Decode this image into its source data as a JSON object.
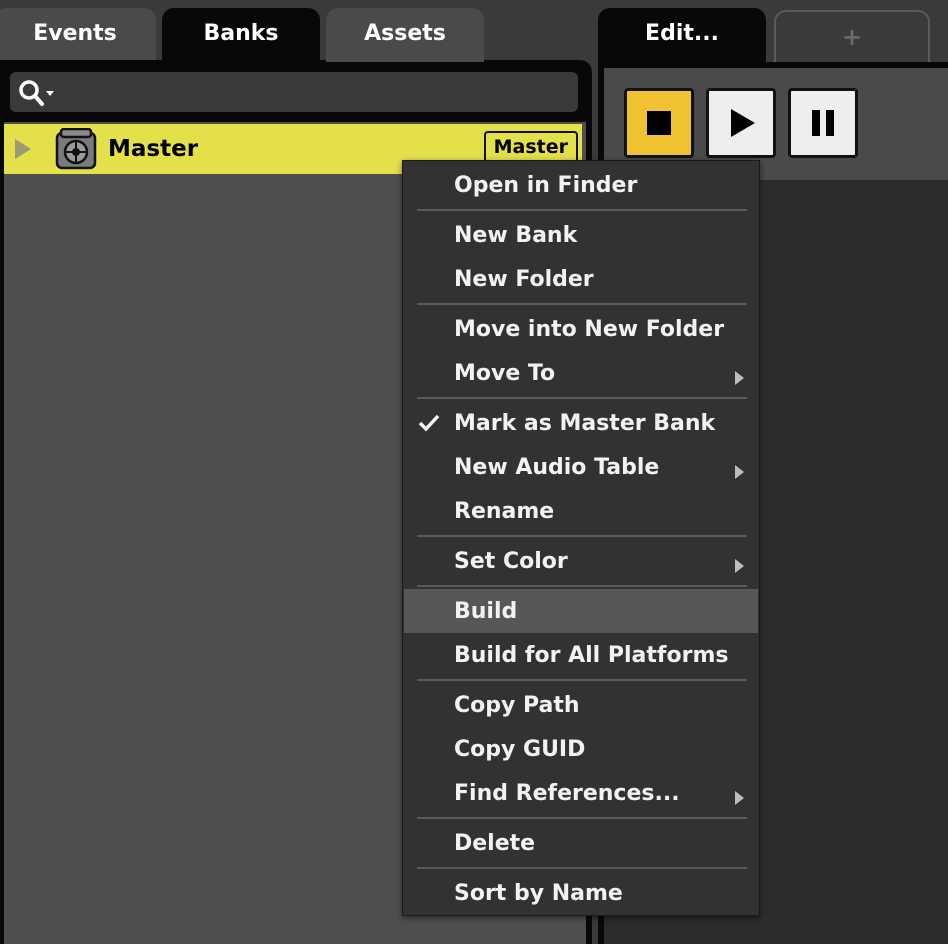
{
  "tabs": {
    "events": "Events",
    "banks": "Banks",
    "assets": "Assets"
  },
  "browser": {
    "search_value": "",
    "bank": {
      "name": "Master",
      "badge": "Master"
    }
  },
  "editor": {
    "tab_label": "Edit...",
    "add_tab_label": "+"
  },
  "transport": {
    "stop_icon": "stop-icon",
    "play_icon": "play-icon",
    "pause_icon": "pause-icon"
  },
  "context_menu": {
    "items": [
      {
        "label": "Open in Finder"
      },
      {
        "label": "New Bank"
      },
      {
        "label": "New Folder"
      },
      {
        "label": "Move into New Folder"
      },
      {
        "label": "Move To",
        "submenu": true
      },
      {
        "label": "Mark as Master Bank",
        "checked": true
      },
      {
        "label": "New Audio Table",
        "submenu": true
      },
      {
        "label": "Rename"
      },
      {
        "label": "Set Color",
        "submenu": true
      },
      {
        "label": "Build",
        "highlighted": true
      },
      {
        "label": "Build for All Platforms"
      },
      {
        "label": "Copy Path"
      },
      {
        "label": "Copy GUID"
      },
      {
        "label": "Find References...",
        "submenu": true
      },
      {
        "label": "Delete"
      },
      {
        "label": "Sort by Name"
      }
    ]
  },
  "colors": {
    "selection_yellow": "#e4e04a",
    "stop_button": "#f0c232",
    "menu_background": "#323232",
    "menu_highlight": "#575757"
  }
}
